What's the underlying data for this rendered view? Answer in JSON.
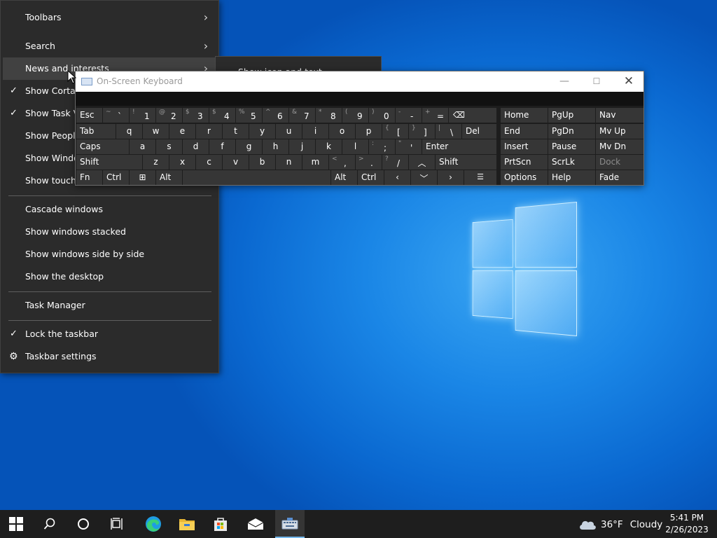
{
  "context_menu": {
    "items": [
      {
        "label": "Toolbars",
        "has_submenu": true,
        "checked": false
      },
      {
        "label": "Search",
        "has_submenu": true,
        "checked": false
      },
      {
        "label": "News and interests",
        "has_submenu": true,
        "checked": false,
        "highlighted": true
      },
      {
        "label": "Show Cortana",
        "checked": true
      },
      {
        "label": "Show Task Vie",
        "checked": true
      },
      {
        "label": "Show People",
        "checked": false
      },
      {
        "label": "Show Window",
        "checked": false
      },
      {
        "label": "Show touch k",
        "checked": false
      },
      {
        "label": "Cascade windows"
      },
      {
        "label": "Show windows stacked"
      },
      {
        "label": "Show windows side by side"
      },
      {
        "label": "Show the desktop"
      },
      {
        "label": "Task Manager"
      },
      {
        "label": "Lock the taskbar",
        "checked": true
      },
      {
        "label": "Taskbar settings",
        "icon": "gear-icon"
      }
    ],
    "submenu_text": "Show icon and text"
  },
  "osk": {
    "title": "On-Screen Keyboard",
    "row1": [
      {
        "shift": "~",
        "main": "`"
      },
      {
        "shift": "!",
        "main": "1"
      },
      {
        "shift": "@",
        "main": "2"
      },
      {
        "shift": "$",
        "main": "3"
      },
      {
        "shift": "$",
        "main": "4"
      },
      {
        "shift": "%",
        "main": "5"
      },
      {
        "shift": "^",
        "main": "6"
      },
      {
        "shift": "&",
        "main": "7"
      },
      {
        "shift": "*",
        "main": "8"
      },
      {
        "shift": "(",
        "main": "9"
      },
      {
        "shift": ")",
        "main": "0"
      },
      {
        "shift": "-",
        "main": "-"
      },
      {
        "shift": "+",
        "main": "="
      }
    ],
    "keys": {
      "esc": "Esc",
      "tab": "Tab",
      "caps": "Caps",
      "shift": "Shift",
      "fn": "Fn",
      "ctrl": "Ctrl",
      "alt": "Alt",
      "del": "Del",
      "enter": "Enter",
      "home": "Home",
      "pgup": "PgUp",
      "nav": "Nav",
      "end": "End",
      "pgdn": "PgDn",
      "mvup": "Mv Up",
      "insert": "Insert",
      "pause": "Pause",
      "mvdn": "Mv Dn",
      "prtscn": "PrtScn",
      "scrlk": "ScrLk",
      "dock": "Dock",
      "options": "Options",
      "help": "Help",
      "fade": "Fade"
    },
    "row2": [
      "q",
      "w",
      "e",
      "r",
      "t",
      "y",
      "u",
      "i",
      "o",
      "p"
    ],
    "row2_brackets": [
      {
        "shift": "{",
        "main": "["
      },
      {
        "shift": "}",
        "main": "]"
      },
      {
        "shift": "|",
        "main": "\\"
      }
    ],
    "row3": [
      "a",
      "s",
      "d",
      "f",
      "g",
      "h",
      "j",
      "k",
      "l"
    ],
    "row3_punct": [
      {
        "shift": ":",
        "main": ";"
      },
      {
        "shift": "\"",
        "main": "'"
      }
    ],
    "row4": [
      "z",
      "x",
      "c",
      "v",
      "b",
      "n",
      "m"
    ],
    "row4_punct": [
      {
        "shift": "<",
        "main": ","
      },
      {
        "shift": ">",
        "main": "."
      },
      {
        "shift": "?",
        "main": "/"
      }
    ]
  },
  "taskbar": {
    "weather_temp": "36°F",
    "weather_desc": "Cloudy",
    "time": "5:41 PM",
    "date": "2/26/2023"
  }
}
